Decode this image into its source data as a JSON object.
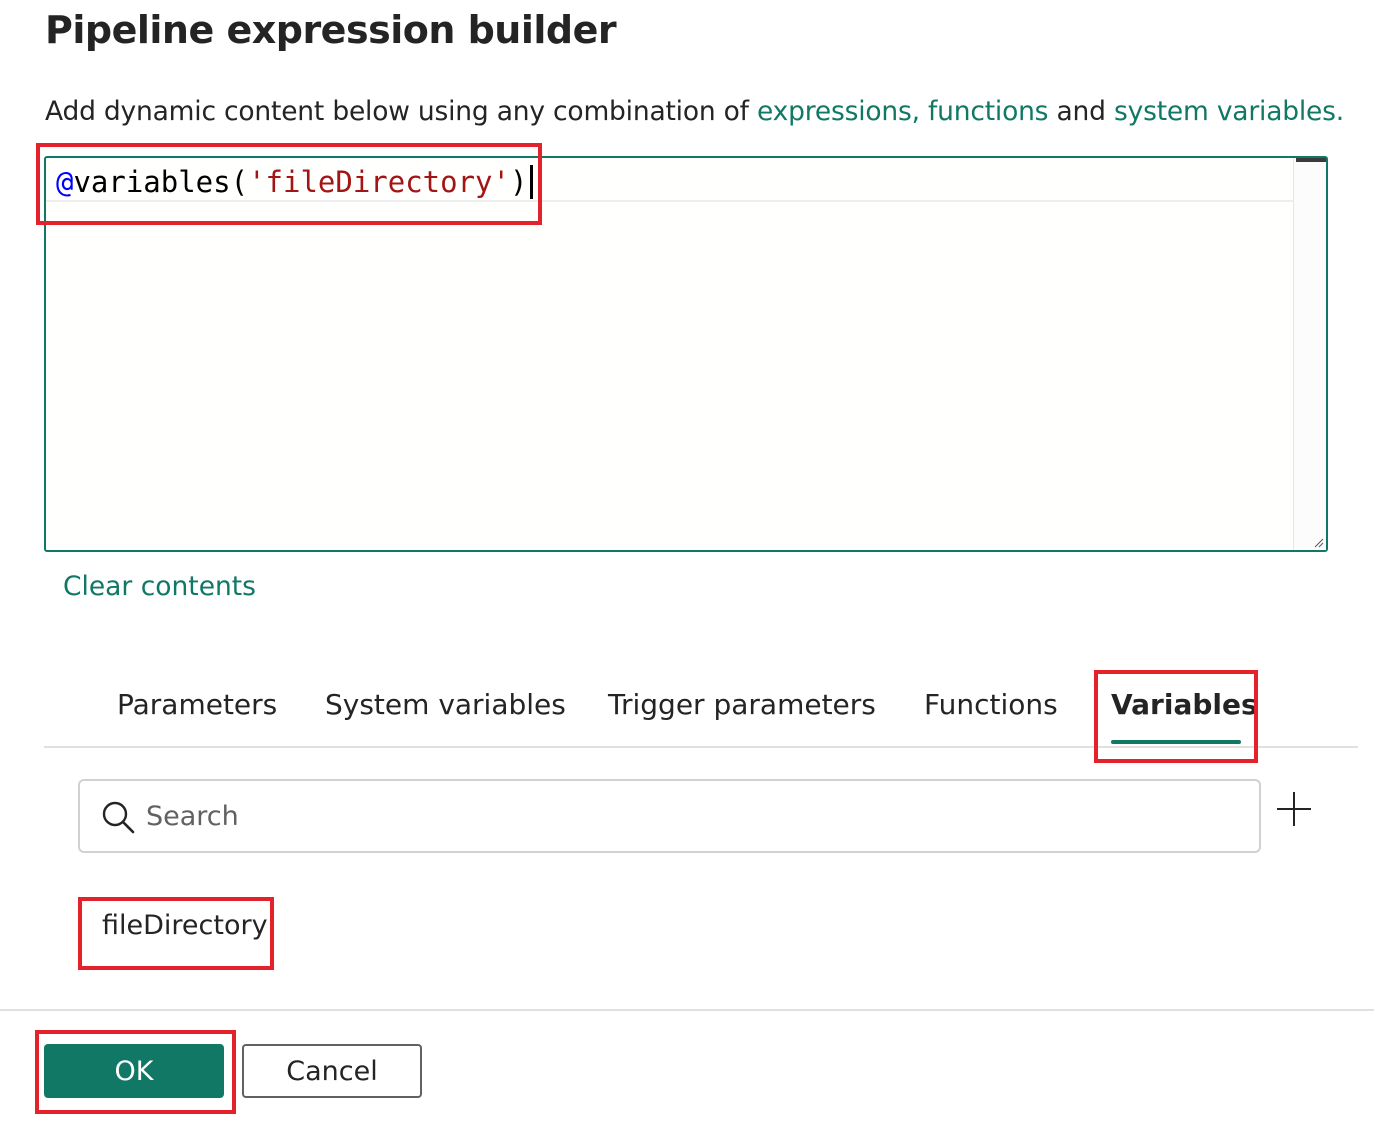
{
  "dialog": {
    "title": "Pipeline expression builder",
    "description": {
      "prefix": "Add dynamic content below using any combination of ",
      "link_expressions": "expressions, ",
      "link_functions": "functions",
      "middle": " and ",
      "link_system_variables": "system variables",
      "suffix": "."
    }
  },
  "editor": {
    "at_sign": "@",
    "function_name": "variables",
    "open_paren": "(",
    "string_arg": "'fileDirectory'",
    "close_paren": ")"
  },
  "clear_contents_label": "Clear contents",
  "tabs": [
    {
      "label": "Parameters",
      "active": false
    },
    {
      "label": "System variables",
      "active": false
    },
    {
      "label": "Trigger parameters",
      "active": false
    },
    {
      "label": "Functions",
      "active": false
    },
    {
      "label": "Variables",
      "active": true
    }
  ],
  "search": {
    "placeholder": "Search",
    "value": ""
  },
  "variables_list": [
    {
      "name": "fileDirectory"
    }
  ],
  "footer": {
    "ok_label": "OK",
    "cancel_label": "Cancel"
  },
  "colors": {
    "accent": "#117865",
    "highlight": "#e3222c",
    "keyword_at": "#0000ff",
    "string": "#a31515"
  }
}
